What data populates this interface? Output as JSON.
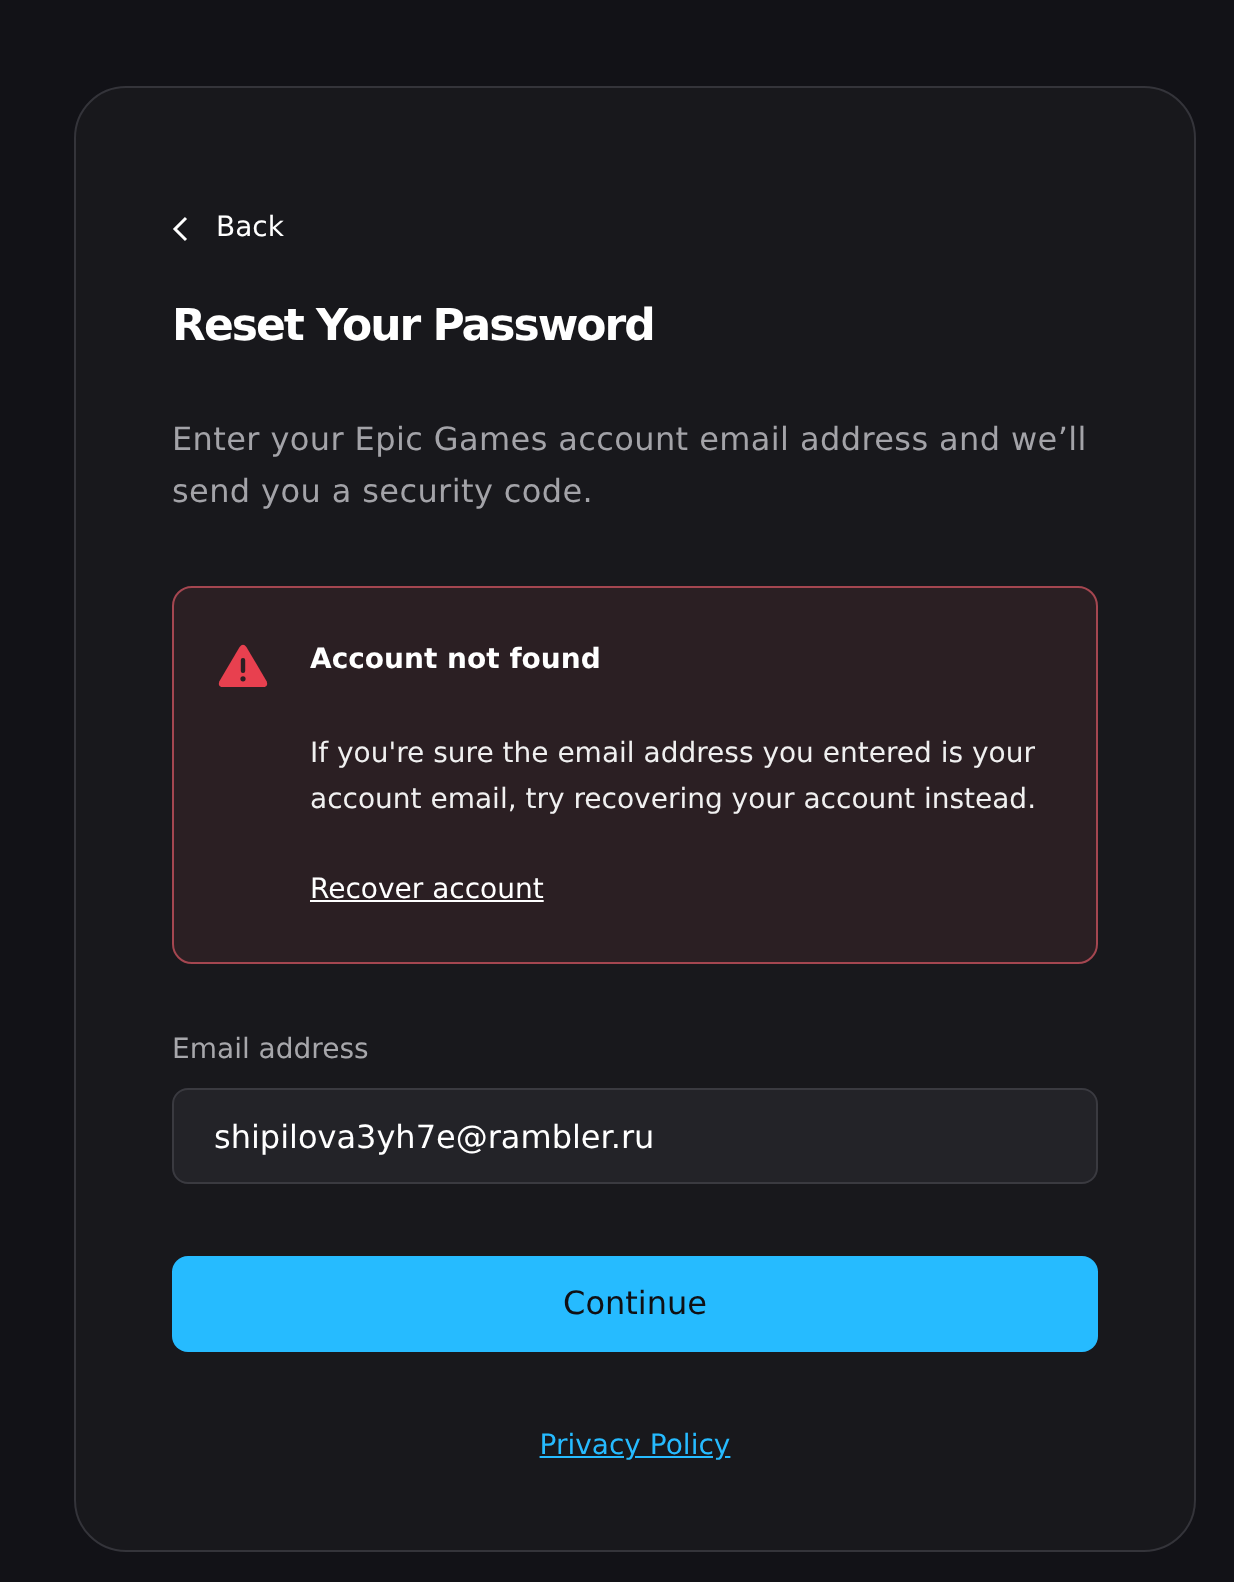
{
  "back_link": {
    "label": "Back"
  },
  "title": "Reset Your Password",
  "description": "Enter your Epic Games account email address and we’ll send you a security code.",
  "alert": {
    "kind": "error",
    "title": "Account not found",
    "message": "If you're sure the email address you entered is your account email, try recovering your account instead.",
    "link": "Recover account"
  },
  "email_field": {
    "label": "Email address",
    "value": "shipilova3yh7e@rambler.ru"
  },
  "buttons": [
    {
      "label": "Continue",
      "kind": "primary"
    }
  ],
  "footer_link": "Privacy Policy"
}
